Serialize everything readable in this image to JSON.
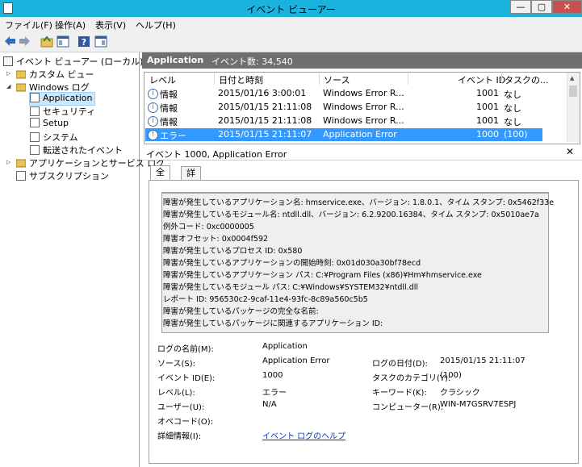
{
  "window": {
    "title": "イベント ビューアー",
    "btn_min": "—",
    "btn_max": "▢",
    "btn_close": "✕"
  },
  "menu": [
    "ファイル(F)",
    "操作(A)",
    "表示(V)",
    "ヘルプ(H)"
  ],
  "tree": {
    "root": "イベント ビューアー (ローカル)",
    "custom_views": "カスタム ビュー",
    "windows_logs": "Windows ログ",
    "logs": [
      "Application",
      "セキュリティ",
      "Setup",
      "システム",
      "転送されたイベント"
    ],
    "app_service_logs": "アプリケーションとサービス ログ",
    "subscriptions": "サブスクリプション"
  },
  "header": {
    "title": "Application",
    "count": "イベント数: 34,540"
  },
  "grid": {
    "columns": [
      "レベル",
      "日付と時刻",
      "ソース",
      "イベント ID",
      "タスクの..."
    ],
    "rows": [
      {
        "level": "情報",
        "datetime": "2015/01/16 3:00:01",
        "source": "Windows Error R...",
        "id": "1001",
        "task": "なし"
      },
      {
        "level": "情報",
        "datetime": "2015/01/15 21:11:08",
        "source": "Windows Error R...",
        "id": "1001",
        "task": "なし"
      },
      {
        "level": "情報",
        "datetime": "2015/01/15 21:11:08",
        "source": "Windows Error R...",
        "id": "1001",
        "task": "なし"
      },
      {
        "level": "エラー",
        "datetime": "2015/01/15 21:11:07",
        "source": "Application Error",
        "id": "1000",
        "task": "(100)"
      }
    ]
  },
  "detail": {
    "title": "イベント 1000, Application Error",
    "close": "✕",
    "tabs": [
      "全般",
      "詳細"
    ],
    "message": [
      "障害が発生しているアプリケーション名: hmservice.exe、バージョン: 1.8.0.1、タイム スタンプ: 0x5462f33e",
      "障害が発生しているモジュール名: ntdll.dll、バージョン: 6.2.9200.16384、タイム スタンプ: 0x5010ae7a",
      "例外コード: 0xc0000005",
      "障害オフセット: 0x0004f592",
      "障害が発生しているプロセス ID: 0x580",
      "障害が発生しているアプリケーションの開始時刻: 0x01d030a30bf78ecd",
      "障害が発生しているアプリケーション パス: C:¥Program Files (x86)¥Hm¥hmservice.exe",
      "障害が発生しているモジュール パス: C:¥Windows¥SYSTEM32¥ntdll.dll",
      "レポート ID: 956530c2-9caf-11e4-93fc-8c89a560c5b5",
      "障害が発生しているパッケージの完全な名前:",
      "障害が発生しているパッケージに関連するアプリケーション ID:"
    ],
    "fields": {
      "log_name_label": "ログの名前(M):",
      "log_name": "Application",
      "source_label": "ソース(S):",
      "source": "Application Error",
      "logged_label": "ログの日付(D):",
      "logged": "2015/01/15 21:11:07",
      "event_id_label": "イベント ID(E):",
      "event_id": "1000",
      "task_label": "タスクのカテゴリ(Y):",
      "task": "(100)",
      "level_label": "レベル(L):",
      "level": "エラー",
      "keywords_label": "キーワード(K):",
      "keywords": "クラシック",
      "user_label": "ユーザー(U):",
      "user": "N/A",
      "computer_label": "コンピューター(R):",
      "computer": "WIN-M7GSRV7ESPJ",
      "opcode_label": "オペコード(O):",
      "more_info_label": "詳細情報(I):",
      "more_info_link": "イベント ログのヘルプ"
    }
  }
}
